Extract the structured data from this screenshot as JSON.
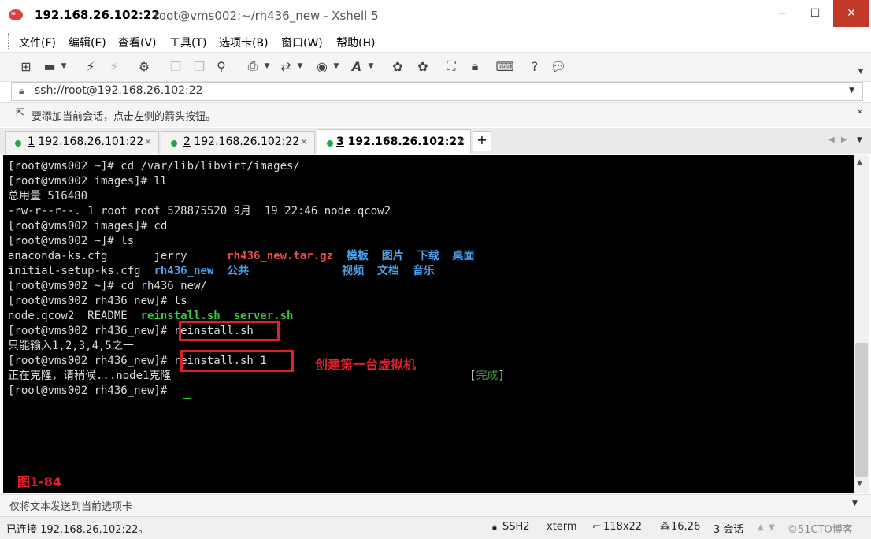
{
  "window": {
    "title_ip": "192.168.26.102:22",
    "title_rest": "root@vms002:~/rh436_new - Xshell 5",
    "min": "−",
    "max": "☐",
    "close": "✕"
  },
  "menu": [
    "文件(F)",
    "编辑(E)",
    "查看(V)",
    "工具(T)",
    "选项卡(B)",
    "窗口(W)",
    "帮助(H)"
  ],
  "address": "ssh://root@192.168.26.102:22",
  "hint": "要添加当前会话，点击左侧的箭头按钮。",
  "tabs": [
    {
      "num": "1",
      "label": " 192.168.26.101:22"
    },
    {
      "num": "2",
      "label": " 192.168.26.102:22"
    },
    {
      "num": "3",
      "label": " 192.168.26.102:22"
    }
  ],
  "terminal": {
    "l1": "[root@vms002 ~]# cd /var/lib/libvirt/images/",
    "l2": "[root@vms002 images]# ll",
    "l3": "总用量 516480",
    "l4": "-rw-r--r--. 1 root root 528875520 9月  19 22:46 node.qcow2",
    "l5": "[root@vms002 images]# cd",
    "l6": "[root@vms002 ~]# ls",
    "l7a": "anaconda-ks.cfg       jerry      ",
    "l7b": "rh436_new.tar.gz",
    "l7c": "模板  图片  下载  桌面",
    "l8a": "initial-setup-ks.cfg  ",
    "l8b": "rh436_new",
    "l8c": "公共",
    "l8d": "视频  文档  音乐",
    "l9": "[root@vms002 ~]# cd rh436_new/",
    "l10": "[root@vms002 rh436_new]# ls",
    "l11a": "node.qcow2  README  ",
    "l11b": "reinstall.sh  server.sh",
    "l12a": "[root@vms002 rh436_new]# ",
    "l12b": "reinstall.sh",
    "l13": "只能输入1,2,3,4,5之一",
    "l14a": "[root@vms002 rh436_new]# ",
    "l14b": "reinstall.sh 1",
    "l15a": "正在克隆，请稍候...node1克隆",
    "l15b": "[",
    "l15c": "完成",
    "l15d": "]",
    "l16": "[root@vms002 rh436_new]# "
  },
  "annotations": {
    "create_vm": "创建第一台虚拟机",
    "figure": "图1-84"
  },
  "sendbar": "仅将文本发送到当前选项卡",
  "status": {
    "connected": "已连接 192.168.26.102:22。",
    "protocol": "SSH2",
    "term": "xterm",
    "size": "118x22",
    "pos": "16,26",
    "sessions": "3 会话",
    "watermark": "©51CTO博客"
  },
  "colors": {
    "accent_red": "#e0202a",
    "terminal_bg": "#000000",
    "dir_blue": "#4aa3f0",
    "exec_green": "#3cc83c"
  }
}
